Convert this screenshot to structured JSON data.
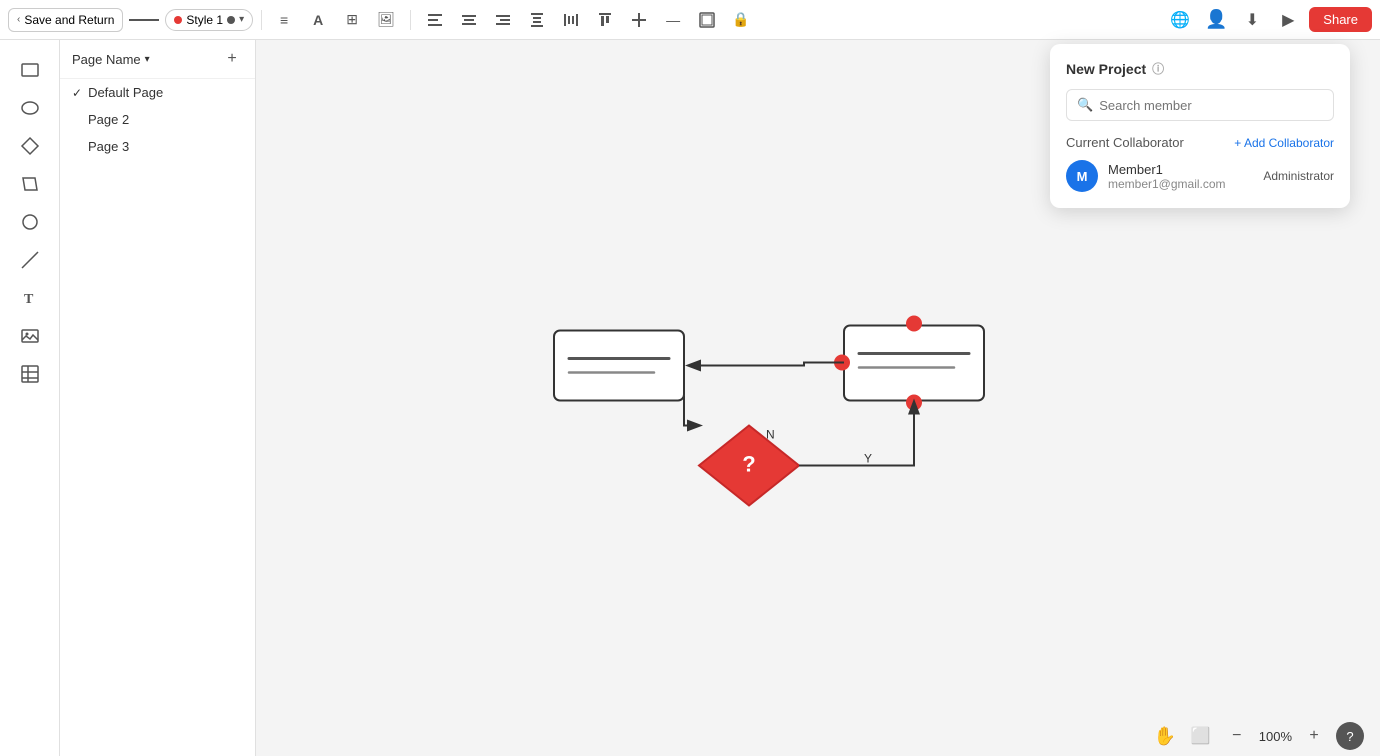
{
  "toolbar": {
    "save_return_label": "Save and Return",
    "style_label": "Style 1",
    "share_label": "Share",
    "icons": [
      "list",
      "A",
      "grid",
      "image"
    ],
    "align_icons": [
      "align-left",
      "align-center",
      "align-right",
      "align-top",
      "align-middle",
      "align-bottom",
      "distribute-h",
      "distribute-v",
      "lock"
    ]
  },
  "sidebar": {
    "pages_title": "Page Name",
    "add_page_label": "+",
    "pages": [
      {
        "name": "Default Page",
        "active": true
      },
      {
        "name": "Page 2",
        "active": false
      },
      {
        "name": "Page 3",
        "active": false
      }
    ]
  },
  "collab_panel": {
    "title": "New Project",
    "search_placeholder": "Search member",
    "current_collaborator_label": "Current Collaborator",
    "add_collaborator_label": "+ Add Collaborator",
    "members": [
      {
        "avatar_letter": "M",
        "name": "Member1",
        "email": "member1@gmail.com",
        "role": "Administrator"
      }
    ]
  },
  "zoom": {
    "level": "100%",
    "minus_label": "−",
    "plus_label": "+"
  }
}
